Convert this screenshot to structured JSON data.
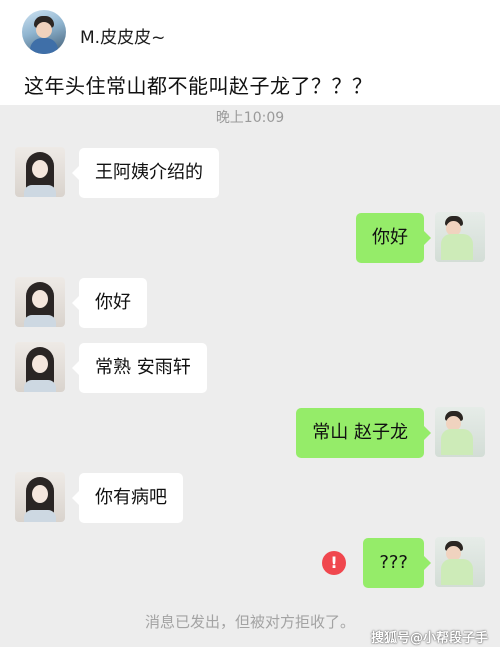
{
  "post": {
    "author_name": "M.皮皮皮~",
    "text": "这年头住常山都不能叫赵子龙了？？？"
  },
  "chat": {
    "timestamp": "晚上10:09",
    "messages": [
      {
        "side": "left",
        "text": "王阿姨介绍的"
      },
      {
        "side": "right",
        "text": "你好"
      },
      {
        "side": "left",
        "text": "你好"
      },
      {
        "side": "left",
        "text": "常熟 安雨轩"
      },
      {
        "side": "right",
        "text": "常山 赵子龙"
      },
      {
        "side": "left",
        "text": "你有病吧"
      },
      {
        "side": "right",
        "text": "???",
        "status": "rejected"
      }
    ],
    "error_icon": "!",
    "system_notice": "消息已发出，但被对方拒收了。"
  },
  "watermark": "搜狐号@小帮段子手",
  "colors": {
    "chat_bg": "#ededed",
    "bubble_self": "#95ec69",
    "bubble_other": "#ffffff",
    "error": "#f0474e",
    "muted_text": "#a3a3a3"
  },
  "icons": {
    "error": "exclamation-circle-icon"
  }
}
